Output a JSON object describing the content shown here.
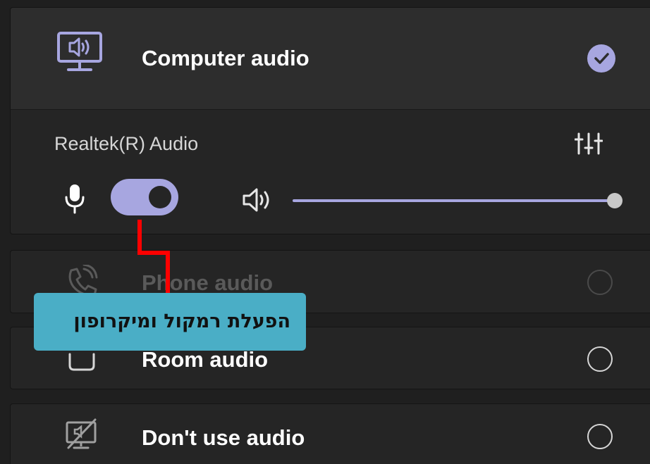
{
  "computer_audio": {
    "label": "Computer audio",
    "selected": true,
    "icon": "monitor-speaker-icon"
  },
  "device": {
    "name": "Realtek(R) Audio",
    "settings_icon": "sliders-icon",
    "mic_icon": "microphone-icon",
    "mic_toggle_on": true,
    "speaker_icon": "speaker-icon",
    "volume_fraction": 1.0
  },
  "options": {
    "phone": {
      "label": "Phone audio",
      "icon": "phone-icon",
      "disabled": true
    },
    "room": {
      "label": "Room audio",
      "icon": "room-device-icon"
    },
    "none": {
      "label": "Don't use audio",
      "icon": "no-audio-icon"
    }
  },
  "callout": {
    "text": "הפעלת רמקול ומיקרופון",
    "line_color": "#ff0000",
    "background": "#4aaec6"
  },
  "colors": {
    "accent": "#a7a6e0",
    "background": "#1f1f1f"
  }
}
